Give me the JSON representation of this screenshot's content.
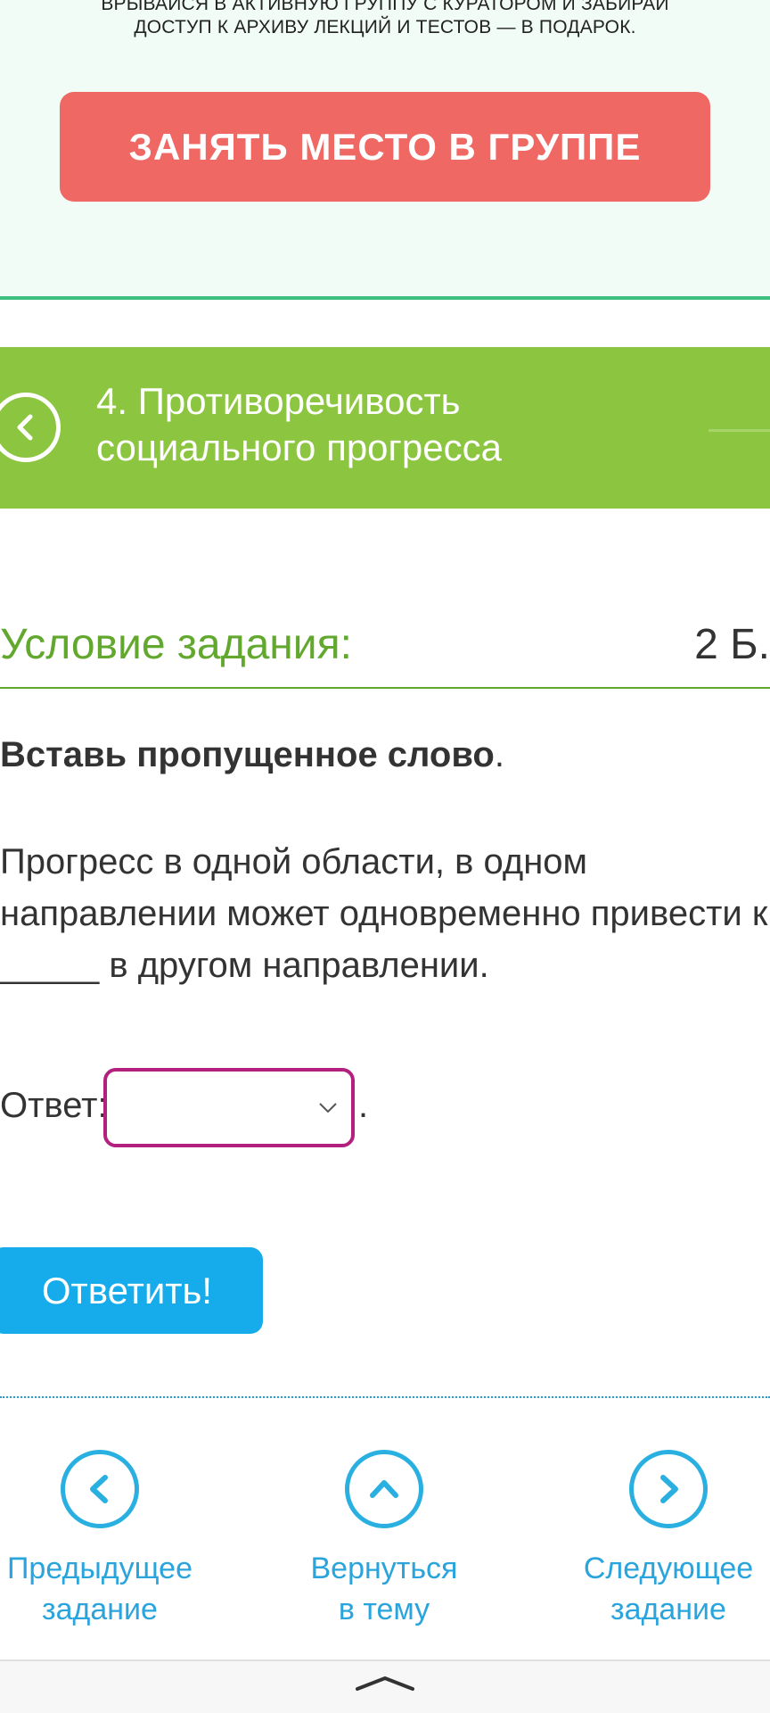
{
  "promo": {
    "text_line1": "Врывайся в активную группу с куратором и забирай",
    "text_line2": "доступ к архиву лекций и тестов — в подарок.",
    "button_label": "ЗАНЯТЬ МЕСТО В ГРУППЕ",
    "button_color": "#ef6863",
    "background_color": "#f1fcf7"
  },
  "topic": {
    "title": "4. Противоречивость социального прогресса",
    "back_icon": "chevron-left-icon",
    "background_color": "#8cc540"
  },
  "task": {
    "condition_title": "Условие задания:",
    "points": "2 Б.",
    "instruction_bold": "Вставь пропущенное слово",
    "instruction_tail": ".",
    "text": "Прогресс в одной области, в одном направлении может одновременно привести к _____ в другом направлении.",
    "accent_color": "#62a82e"
  },
  "answer": {
    "label": "Ответ:",
    "selected_value": "",
    "trailing": ".",
    "border_color": "#b3207e"
  },
  "submit": {
    "label": "Ответить!",
    "color": "#16aceb"
  },
  "nav": {
    "prev": {
      "line1": "Предыдущее",
      "line2": "задание",
      "icon": "chevron-left-icon"
    },
    "up": {
      "line1": "Вернуться",
      "line2": "в тему",
      "icon": "chevron-up-icon"
    },
    "next": {
      "line1": "Следующее",
      "line2": "задание",
      "icon": "chevron-right-icon"
    },
    "color": "#2ab0e0"
  }
}
